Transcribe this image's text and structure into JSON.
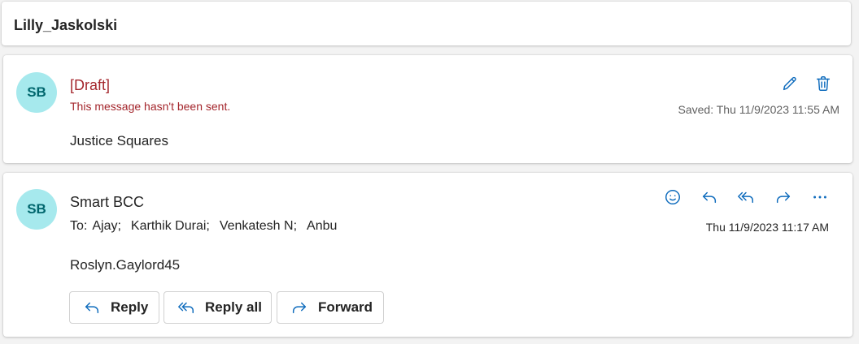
{
  "thread": {
    "subject": "Lilly_Jaskolski"
  },
  "draft": {
    "avatar_initials": "SB",
    "label": "[Draft]",
    "note": "This message hasn't been sent.",
    "saved": "Saved: Thu 11/9/2023 11:55 AM",
    "body": "Justice Squares",
    "icons": {
      "edit": "pencil-icon",
      "delete": "trash-icon"
    }
  },
  "message": {
    "avatar_initials": "SB",
    "sender": "Smart BCC",
    "to_label": "To:",
    "recipients": [
      "Ajay;",
      "Karthik Durai;",
      "Venkatesh N;",
      "Anbu"
    ],
    "time": "Thu 11/9/2023 11:17 AM",
    "body": "Roslyn.Gaylord45",
    "icons": [
      "emoji-icon",
      "reply-icon",
      "reply-all-icon",
      "forward-icon",
      "more-icon"
    ],
    "buttons": {
      "reply": "Reply",
      "reply_all": "Reply all",
      "forward": "Forward"
    }
  },
  "colors": {
    "accent": "#0f6cbd",
    "draft_red": "#a4262c",
    "avatar_bg": "#a6e9ed",
    "avatar_fg": "#00666d"
  }
}
